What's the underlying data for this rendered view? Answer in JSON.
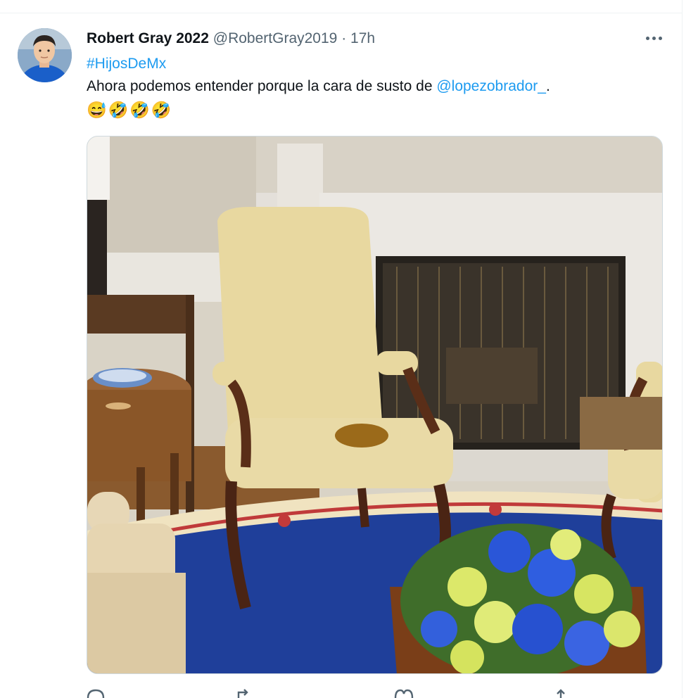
{
  "tweet": {
    "author_name": "Robert Gray 2022",
    "handle": "@RobertGray2019",
    "separator": "·",
    "time": "17h",
    "hashtag": "#HijosDeMx",
    "text_before": "Ahora podemos entender porque la cara de susto de ",
    "mention": "@lopezobrador_",
    "text_after": ".",
    "emojis": "😅🤣🤣🤣"
  },
  "media": {
    "description_icon": "photo",
    "colors": {
      "wall": "#d9d3c6",
      "mantel": "#e4e0da",
      "chair": "#e8d8a0",
      "rug_blue": "#1f3f9a",
      "stain": "#9b6a1a"
    }
  },
  "actions": {
    "reply_icon": "reply-icon",
    "retweet_icon": "retweet-icon",
    "like_icon": "like-icon",
    "share_icon": "share-icon"
  }
}
